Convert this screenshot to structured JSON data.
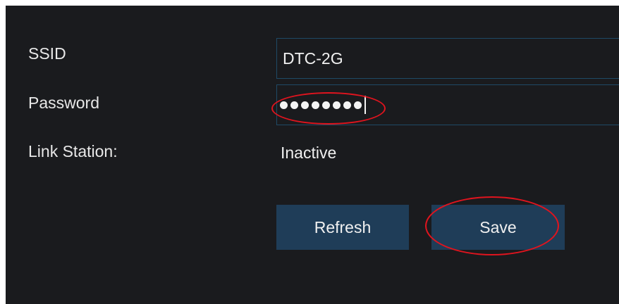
{
  "form": {
    "ssid": {
      "label": "SSID",
      "value": "DTC-2G"
    },
    "password": {
      "label": "Password",
      "masked_length": 8
    },
    "link_station": {
      "label": "Link Station:",
      "value": "Inactive"
    }
  },
  "buttons": {
    "refresh_label": "Refresh",
    "save_label": "Save"
  },
  "colors": {
    "background": "#1a1b1e",
    "field_border": "#1f4a66",
    "button": "#1f3d58",
    "annotation": "#e0141e",
    "text": "#f0f0f0"
  }
}
